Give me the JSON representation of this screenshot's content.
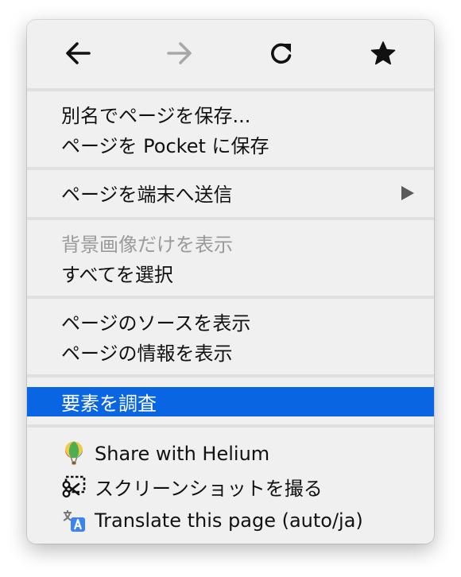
{
  "nav": {
    "back_icon": "arrow-left-icon",
    "forward_icon": "arrow-right-icon",
    "reload_icon": "reload-icon",
    "bookmark_icon": "star-icon"
  },
  "groups": {
    "save": {
      "save_as": "別名でページを保存...",
      "save_to_pocket": "ページを Pocket に保存"
    },
    "send": {
      "send_to_device": "ページを端末へ送信"
    },
    "view": {
      "view_background": "背景画像だけを表示",
      "select_all": "すべてを選択"
    },
    "source": {
      "view_source": "ページのソースを表示",
      "page_info": "ページの情報を表示"
    },
    "inspect": {
      "inspect_element": "要素を調査"
    },
    "extensions": {
      "share_helium": "Share with Helium",
      "screenshot": "スクリーンショットを撮る",
      "translate": "Translate this page (auto/ja)"
    }
  },
  "colors": {
    "menu_bg": "#f0f0f0",
    "highlight": "#0965e2",
    "disabled_text": "#9a9a9a",
    "separator": "#e0e0e0"
  }
}
